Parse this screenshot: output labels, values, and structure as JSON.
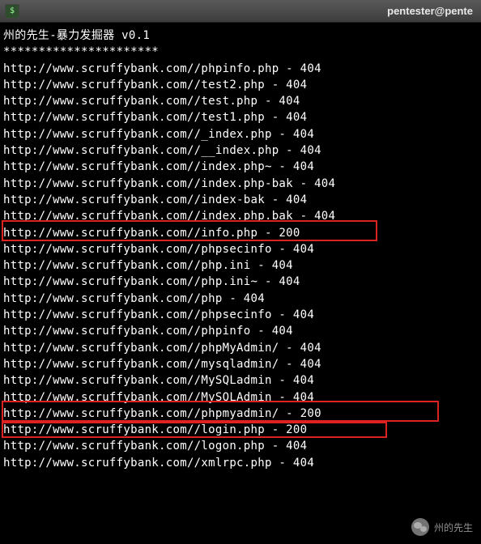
{
  "titlebar": {
    "text": "pentester@pente"
  },
  "header": {
    "title": "州的先生-暴力发掘器 v0.1",
    "divider": "**********************"
  },
  "results": [
    {
      "url": "http://www.scruffybank.com//phpinfo.php",
      "status": "404"
    },
    {
      "url": "http://www.scruffybank.com//test2.php",
      "status": "404"
    },
    {
      "url": "http://www.scruffybank.com//test.php",
      "status": "404"
    },
    {
      "url": "http://www.scruffybank.com//test1.php",
      "status": "404"
    },
    {
      "url": "http://www.scruffybank.com//_index.php",
      "status": "404"
    },
    {
      "url": "http://www.scruffybank.com//__index.php",
      "status": "404"
    },
    {
      "url": "http://www.scruffybank.com//index.php~",
      "status": "404"
    },
    {
      "url": "http://www.scruffybank.com//index.php-bak",
      "status": "404"
    },
    {
      "url": "http://www.scruffybank.com//index-bak",
      "status": "404"
    },
    {
      "url": "http://www.scruffybank.com//index.php.bak",
      "status": "404"
    },
    {
      "url": "http://www.scruffybank.com//info.php",
      "status": "200"
    },
    {
      "url": "http://www.scruffybank.com//phpsecinfo",
      "status": "404"
    },
    {
      "url": "http://www.scruffybank.com//php.ini",
      "status": "404"
    },
    {
      "url": "http://www.scruffybank.com//php.ini~",
      "status": "404"
    },
    {
      "url": "http://www.scruffybank.com//php",
      "status": "404"
    },
    {
      "url": "http://www.scruffybank.com//phpsecinfo",
      "status": "404"
    },
    {
      "url": "http://www.scruffybank.com//phpinfo",
      "status": "404"
    },
    {
      "url": "http://www.scruffybank.com//phpMyAdmin/",
      "status": "404"
    },
    {
      "url": "http://www.scruffybank.com//mysqladmin/",
      "status": "404"
    },
    {
      "url": "http://www.scruffybank.com//MySQLadmin",
      "status": "404"
    },
    {
      "url": "http://www.scruffybank.com//MySQLAdmin",
      "status": "404"
    },
    {
      "url": "http://www.scruffybank.com//phpmyadmin/",
      "status": "200"
    },
    {
      "url": "http://www.scruffybank.com//login.php",
      "status": "200"
    },
    {
      "url": "http://www.scruffybank.com//logon.php",
      "status": "404"
    },
    {
      "url": "http://www.scruffybank.com//xmlrpc.php",
      "status": "404"
    }
  ],
  "watermark": {
    "text": "州的先生"
  }
}
